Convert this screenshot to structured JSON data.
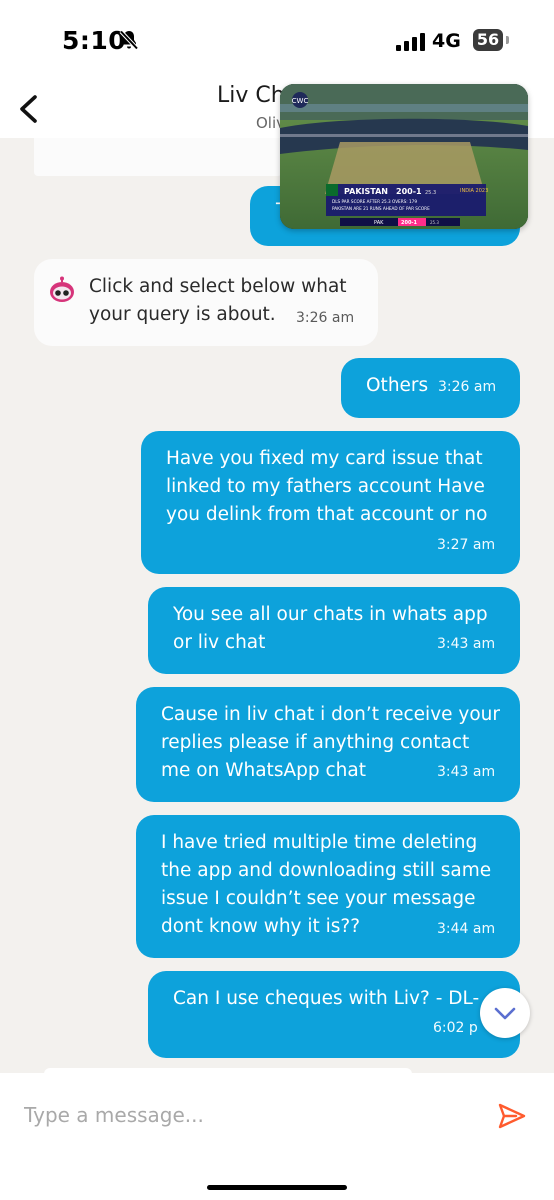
{
  "status_bar": {
    "time": "5:10",
    "network": "4G",
    "battery": "56"
  },
  "header": {
    "title": "Liv Ch",
    "subtitle": "Oliv"
  },
  "pip_video": {
    "score_team": "PAKISTAN",
    "score": "200-1",
    "overs": "25.3",
    "par_line": "DLS PAR SCORE AFTER 25.3 OVERS: 179",
    "ahead_line": "PAKISTAN ARE 21 RUNS AHEAD OF PAR SCORE",
    "tournament": "INDIA 2023",
    "mini_team": "PAK",
    "mini_score": "200-1",
    "mini_overs": "25.3"
  },
  "partial_top_bubble": {
    "text": "T"
  },
  "messages": [
    {
      "side": "in",
      "text": "Click and select below what\nyour query is about.",
      "time": "3:26 am"
    },
    {
      "side": "out",
      "text": "Others",
      "time": "3:26 am"
    },
    {
      "side": "out",
      "text": "Have you fixed my card issue that\nlinked to my fathers account Have\nyou delink from that account or no",
      "time": "3:27 am"
    },
    {
      "side": "out",
      "text": "You see all our chats in whats app\nor liv chat",
      "time": "3:43 am"
    },
    {
      "side": "out",
      "text": "Cause in liv chat i don’t receive your\nreplies please if anything contact\nme on WhatsApp chat",
      "time": "3:43 am"
    },
    {
      "side": "out",
      "text": "I have tried multiple time deleting\nthe app and downloading still same\nissue I couldn’t see your message\ndont know why it is??",
      "time": "3:44 am"
    },
    {
      "side": "out",
      "text": "Can I use cheques with Liv? - DL-",
      "time": "6:02 p"
    }
  ],
  "composer": {
    "placeholder": "Type a message..."
  },
  "colors": {
    "outgoing_bubble": "#0da2db",
    "incoming_bubble": "#fbfbfb",
    "send_icon": "#ff5b2e",
    "background": "#f3f1ee"
  },
  "icons": {
    "back": "chevron-left-icon",
    "mute": "bell-slash-icon",
    "bot": "bot-avatar-icon",
    "scroll": "chevron-down-icon",
    "send": "send-icon"
  }
}
